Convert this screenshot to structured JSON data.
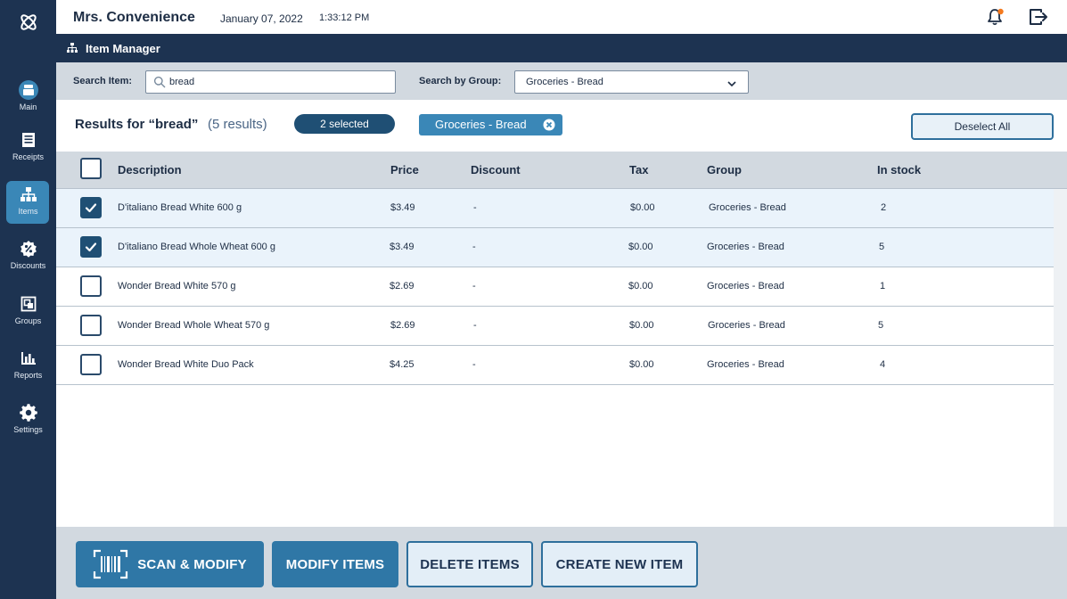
{
  "header": {
    "store_name": "Mrs. Convenience",
    "date": "January 07, 2022",
    "time": "1:33:12 PM",
    "notification_dot_color": "#f47a1f"
  },
  "sidebar": {
    "items": [
      {
        "label": "Main",
        "icon": "register-icon"
      },
      {
        "label": "Receipts",
        "icon": "receipt-icon"
      },
      {
        "label": "Items",
        "icon": "hierarchy-icon",
        "active": true
      },
      {
        "label": "Discounts",
        "icon": "discount-badge-icon"
      },
      {
        "label": "Groups",
        "icon": "groups-icon"
      },
      {
        "label": "Reports",
        "icon": "bar-chart-icon"
      },
      {
        "label": "Settings",
        "icon": "gear-icon"
      }
    ]
  },
  "page": {
    "title": "Item Manager"
  },
  "search": {
    "item_label": "Search Item:",
    "item_value": "bread",
    "group_label": "Search by Group:",
    "group_value": "Groceries - Bread"
  },
  "results": {
    "title": "Results for “bread”",
    "count": "(5 results)",
    "selected_badge": "2 selected",
    "filter_chip": "Groceries - Bread",
    "deselect_label": "Deselect All"
  },
  "table": {
    "columns": [
      "Description",
      "Price",
      "Discount",
      "Tax",
      "Group",
      "In stock"
    ],
    "rows": [
      {
        "description": "D'italiano Bread White 600 g",
        "price": "$3.49",
        "discount": "-",
        "tax": "$0.00",
        "group": "Groceries - Bread",
        "stock": "2",
        "selected": true
      },
      {
        "description": "D'italiano Bread Whole Wheat 600 g",
        "price": "$3.49",
        "discount": "-",
        "tax": "$0.00",
        "group": "Groceries - Bread",
        "stock": "5",
        "selected": true
      },
      {
        "description": "Wonder Bread White 570 g",
        "price": "$2.69",
        "discount": "-",
        "tax": "$0.00",
        "group": "Groceries - Bread",
        "stock": "1",
        "selected": false
      },
      {
        "description": "Wonder Bread Whole Wheat 570 g",
        "price": "$2.69",
        "discount": "-",
        "tax": "$0.00",
        "group": "Groceries - Bread",
        "stock": "5",
        "selected": false
      },
      {
        "description": "Wonder Bread White Duo Pack",
        "price": "$4.25",
        "discount": "-",
        "tax": "$0.00",
        "group": "Groceries - Bread",
        "stock": "4",
        "selected": false
      }
    ]
  },
  "toolbar": {
    "scan_label": "SCAN & MODIFY",
    "modify_label": "MODIFY ITEMS",
    "delete_label": "DELETE ITEMS",
    "create_label": "CREATE NEW ITEM"
  },
  "colors": {
    "sidebar": "#1d3351",
    "accent": "#3a87b7",
    "primary_button": "#2f77a6",
    "selected_row": "#eaf3fb"
  }
}
